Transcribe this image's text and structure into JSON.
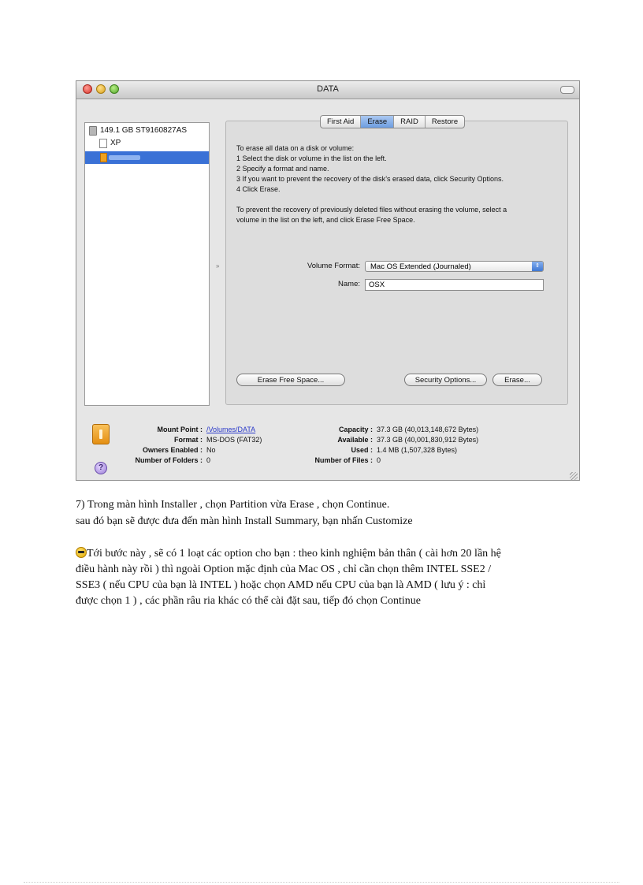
{
  "window": {
    "title": "DATA",
    "colors": {
      "close": "#d8352a",
      "minimize": "#d9a11b",
      "zoom": "#53a52a",
      "selection": "#3a71d6"
    }
  },
  "sidebar": {
    "items": [
      {
        "label": "149.1 GB ST9160827AS",
        "icon": "hard-disk-icon"
      },
      {
        "label": "XP",
        "icon": "document-icon"
      },
      {
        "label": "",
        "icon": "usb-volume-icon",
        "selected": true
      }
    ]
  },
  "tabs": [
    "First Aid",
    "Erase",
    "RAID",
    "Restore"
  ],
  "active_tab": "Erase",
  "instructions": [
    "To erase all data on a disk or volume:",
    "1 Select the disk or volume in the list on the left.",
    "2 Specify a format and name.",
    "3 If you want to prevent the recovery of the disk’s erased data, click Security Options.",
    "4 Click Erase.",
    "To prevent the recovery of previously deleted files without erasing the volume, select a",
    "volume in the list on the left, and click Erase Free Space."
  ],
  "form": {
    "volume_format_label": "Volume Format:",
    "volume_format_value": "Mac OS Extended (Journaled)",
    "name_label": "Name:",
    "name_value": "OSX"
  },
  "buttons": {
    "erase_free_space": "Erase Free Space...",
    "security_options": "Security Options...",
    "erase": "Erase..."
  },
  "info": {
    "mount_point_label": "Mount Point :",
    "mount_point_value": "/Volumes/DATA",
    "format_label": "Format :",
    "format_value": "MS-DOS (FAT32)",
    "owners_label": "Owners Enabled :",
    "owners_value": "No",
    "folders_label": "Number of Folders :",
    "folders_value": "0",
    "capacity_label": "Capacity :",
    "capacity_value": "37.3 GB (40,013,148,672 Bytes)",
    "available_label": "Available :",
    "available_value": "37.3 GB (40,001,830,912 Bytes)",
    "used_label": "Used :",
    "used_value": "1.4 MB (1,507,328 Bytes)",
    "files_label": "Number of Files :",
    "files_value": "0"
  },
  "text": {
    "line1": "7) Trong màn hình  Installer  , chọn Partition  vừa Erase , chọn Continue.",
    "line2": "sau đó bạn sẽ được đưa đến màn hình  Install  Summary,  bạn nhấn  Customize",
    "line3": "Tới bước này , sẽ có 1 loạt các option cho bạn : theo kinh nghiệm  bản thân ( cài hơn 20 lần hệ",
    "line4": "điều hành này rồi ) thì ngoài Option mặc định  của Mac OS , chỉ cần chọn thêm INTEL SSE2 /",
    "line5": "SSE3 ( nếu CPU của bạn là INTEL ) hoặc chọn AMD nếu CPU của bạn là AMD ( lưu ý : chỉ",
    "line6": "được chọn 1 ) , các phần râu ria khác có thể cài đặt sau, tiếp đó chọn Continue"
  }
}
